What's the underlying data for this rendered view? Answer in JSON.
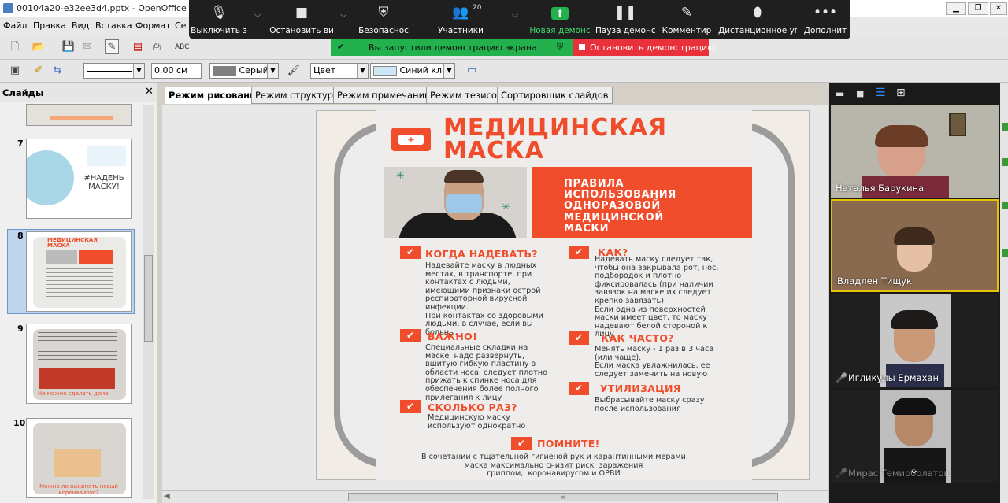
{
  "window": {
    "title": "00104a20-e32ee3d4.pptx - OpenOffice Impr"
  },
  "menu": [
    "Файл",
    "Правка",
    "Вид",
    "Вставка",
    "Формат",
    "Се"
  ],
  "format_toolbar": {
    "line_width": "0,00 см",
    "line_color": "Серый",
    "area_style": "Цвет",
    "area_color": "Синий кла"
  },
  "zoom": {
    "items": [
      {
        "label": "Выключить з",
        "icon": "microphone-icon"
      },
      {
        "label": "Остановить ви",
        "icon": "video-camera-icon"
      },
      {
        "label": "Безопаснос",
        "icon": "shield-icon"
      },
      {
        "label": "Участники",
        "icon": "participants-icon",
        "badge": "20"
      },
      {
        "label": "Новая демонс",
        "icon": "share-screen-icon"
      },
      {
        "label": "Пауза демонс",
        "icon": "pause-icon"
      },
      {
        "label": "Комментир",
        "icon": "pencil-icon"
      },
      {
        "label": "Дистанционное уп",
        "icon": "mouse-icon"
      },
      {
        "label": "Дополнит",
        "icon": "more-icon"
      }
    ],
    "share_banner": "Вы запустили демонстрацию экрана",
    "stop_share": "Остановить демонстрацию"
  },
  "slides_panel": {
    "title": "Слайды",
    "slides": [
      {
        "number": "7",
        "caption": "#НАДЕНЬ МАСКУ!"
      },
      {
        "number": "8",
        "caption": "МЕДИЦИНСКАЯ МАСКА"
      },
      {
        "number": "9",
        "caption": "Не можно сделать дома"
      },
      {
        "number": "10",
        "caption": "Можно ли выкипеть новый коронавирус?"
      }
    ]
  },
  "view_tabs": [
    "Режим рисования",
    "Режим структуры",
    "Режим примечаний",
    "Режим тезисов",
    "Сортировщик слайдов"
  ],
  "poster": {
    "title_line1": "МЕДИЦИНСКАЯ",
    "title_line2": "МАСКА",
    "rules": [
      "ПРАВИЛА",
      "ИСПОЛЬЗОВАНИЯ",
      "ОДНОРАЗОВОЙ",
      "МЕДИЦИНСКОЙ",
      "МАСКИ"
    ],
    "sections": [
      {
        "heading": "КОГДА НАДЕВАТЬ?",
        "text": "Надевайте маску в людных\nместах, в транспорте, при\nконтактах с людьми,\nимеющими признаки острой\nреспираторной вирусной\nинфекции.\nПри контактах со здоровыми\nлюдьми, в случае, если вы\nбольны."
      },
      {
        "heading": "КАК?",
        "text": "Надевать маску следует так,\nчтобы она закрывала рот, нос,\nподбородок и плотно\nфиксировалась (при наличии\nзавязок на маске их следует\nкрепко завязать).\nЕсли одна из поверхностей\nмаски имеет цвет, то маску\nнадевают белой стороной к\nлицу"
      },
      {
        "heading": "ВАЖНО!",
        "text": "Специальные складки на\nмаске  надо развернуть,\nвшитую гибкую пластину в\nобласти носа, следует плотно\nприжать к спинке носа для\nобеспечения более полного\nприлегания к лицу"
      },
      {
        "heading": "КАК ЧАСТО?",
        "text": "Менять маску - 1 раз в 3 часа\n(или чаще).\nЕсли маска увлажнилась, ее\nследует заменить на новую"
      },
      {
        "heading": "УТИЛИЗАЦИЯ",
        "text": "Выбрасывайте маску сразу\nпосле использования"
      },
      {
        "heading": "СКОЛЬКО РАЗ?",
        "text": "Медицинскую маску\nиспользуют однократно"
      }
    ],
    "remember_heading": "ПОМНИТЕ!",
    "remember_text": "В сочетании с тщательной гигиеной рук и карантинными мерами\nмаска максимально снизит риск  заражения\nгриппом,  коронавирусом и ОРВИ"
  },
  "participants": [
    {
      "name": "Наталья Барукина"
    },
    {
      "name": "Владлен Тищук"
    },
    {
      "name": "Игликулы Ермахан"
    },
    {
      "name": "Мирас Темирболатов"
    }
  ]
}
